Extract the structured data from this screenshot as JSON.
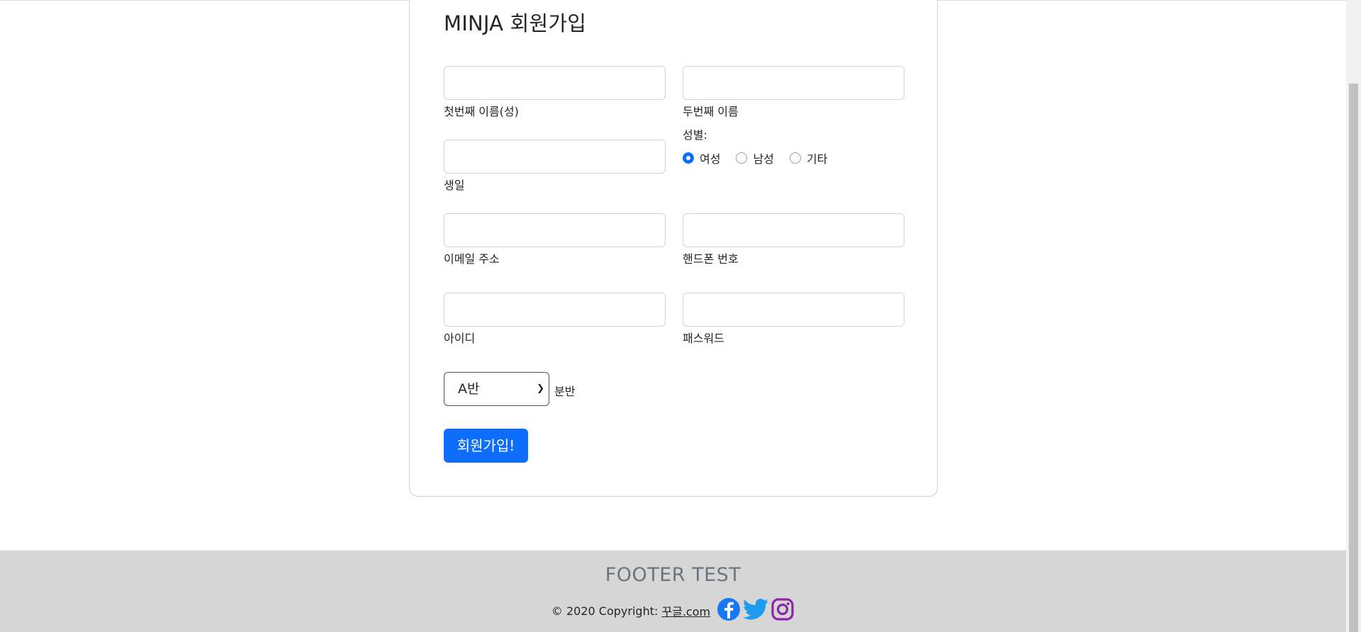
{
  "form": {
    "title": "MINJA 회원가입",
    "fields": {
      "first_name": {
        "label": "첫번째 이름(성)",
        "value": ""
      },
      "last_name": {
        "label": "두번째 이름",
        "value": ""
      },
      "birthday": {
        "label": "생일",
        "value": ""
      },
      "email": {
        "label": "이메일 주소",
        "value": ""
      },
      "phone": {
        "label": "핸드폰 번호",
        "value": ""
      },
      "userid": {
        "label": "아이디",
        "value": ""
      },
      "password": {
        "label": "패스워드",
        "value": ""
      }
    },
    "gender": {
      "label": "성별:",
      "options": [
        "여성",
        "남성",
        "기타"
      ],
      "selected": "여성"
    },
    "class_select": {
      "selected": "A반",
      "label": "분반"
    },
    "submit_label": "회원가입!"
  },
  "footer": {
    "title": "FOOTER TEST",
    "copyright": "© 2020 Copyright:",
    "link_text": "꾸글.com",
    "icons": [
      "facebook-icon",
      "twitter-icon",
      "instagram-icon"
    ],
    "colors": {
      "facebook": "#1877f2",
      "twitter": "#1d9bf0",
      "instagram": "#8e24aa"
    }
  },
  "colors": {
    "primary": "#0d6efd",
    "footer_bg": "#d6d6d6"
  }
}
